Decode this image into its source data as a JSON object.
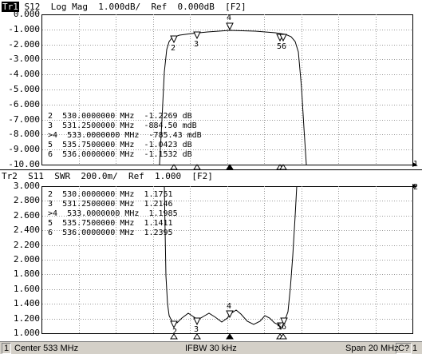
{
  "trace1": {
    "tag": "Tr1",
    "header": " S12  Log Mag  1.000dB/  Ref  0.000dB  [F2]",
    "y_labels": [
      "0.000",
      "-1.000",
      "-2.000",
      "-3.000",
      "-4.000",
      "-5.000",
      "-6.000",
      "-7.000",
      "-8.000",
      "-9.000",
      "-10.00"
    ],
    "ref_marker_label": "1",
    "markers": [
      {
        "id": "2",
        "freq": "530.0000000 MHz",
        "value": "-1.2269 dB",
        "active": false
      },
      {
        "id": "3",
        "freq": "531.2500000 MHz",
        "value": "-884.50 mdB",
        "active": false
      },
      {
        "id": "4",
        "freq": "533.0000000 MHz",
        "value": "-785.43 mdB",
        "active": true
      },
      {
        "id": "5",
        "freq": "535.7500000 MHz",
        "value": "-1.0423 dB",
        "active": false
      },
      {
        "id": "6",
        "freq": "536.0000000 MHz",
        "value": "-1.1532 dB",
        "active": false
      }
    ],
    "curve_label_2": "2",
    "curve_label_3": "3",
    "curve_label_4": "4",
    "curve_label_56": "56"
  },
  "trace2": {
    "tag": "Tr2",
    "header": "Tr2  S11  SWR  200.0m/  Ref  1.000  [F2]",
    "y_labels": [
      "3.000",
      "2.800",
      "2.600",
      "2.400",
      "2.200",
      "2.000",
      "1.800",
      "1.600",
      "1.400",
      "1.200",
      "1.000"
    ],
    "ref_marker_label": "2",
    "markers": [
      {
        "id": "2",
        "freq": "530.0000000 MHz",
        "value": "1.1751",
        "active": false
      },
      {
        "id": "3",
        "freq": "531.2500000 MHz",
        "value": "1.2146",
        "active": false
      },
      {
        "id": "4",
        "freq": "533.0000000 MHz",
        "value": "1.1985",
        "active": true
      },
      {
        "id": "5",
        "freq": "535.7500000 MHz",
        "value": "1.1411",
        "active": false
      },
      {
        "id": "6",
        "freq": "536.0000000 MHz",
        "value": "1.2395",
        "active": false
      }
    ],
    "curve_label_2": "2",
    "curve_label_3": "3",
    "curve_label_4": "4",
    "curve_label_56": "56"
  },
  "status": {
    "channel": "1",
    "center": "Center 533 MHz",
    "ifbw": "IFBW 30 kHz",
    "span": "Span 20 MHz",
    "cal": "C?",
    "ch_end": "1"
  }
}
